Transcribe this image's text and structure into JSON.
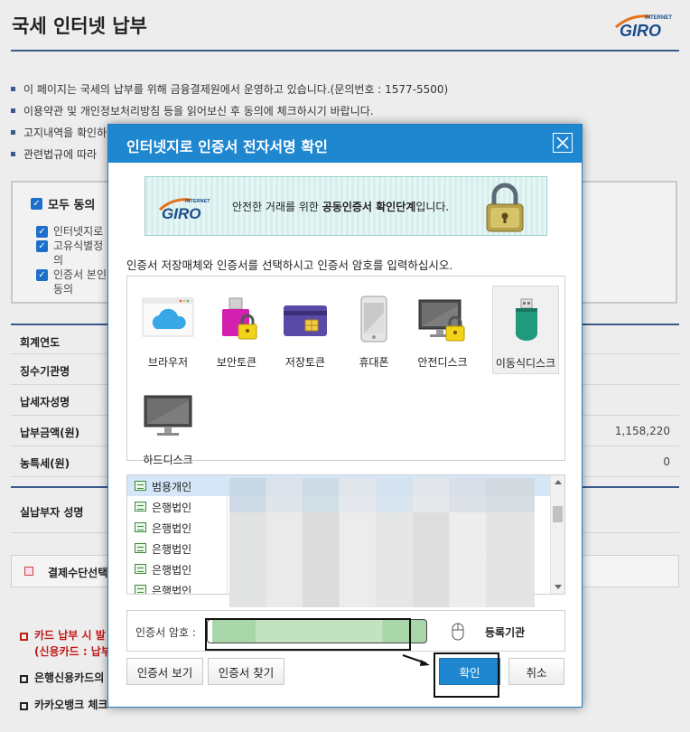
{
  "background": {
    "title": "국세 인터넷 납부",
    "logo_small": "INTERNET",
    "logo_main": "GIRO",
    "bullets": [
      "이 페이지는 국세의 납부를 위해 금융결제원에서 운영하고 있습니다.(문의번호 : 1577-5500)",
      "이용약관 및 개인정보처리방침 등을 읽어보신 후 동의에 체크하시기 바랍니다.",
      "고지내역을 확인하",
      "관련법규에 따라"
    ],
    "agree_all": "모두 동의",
    "agree_items": [
      "인터넷지로",
      "고유식별정",
      "의",
      "인증서 본인",
      "동의"
    ],
    "table": [
      {
        "label": "회계연도",
        "value": ""
      },
      {
        "label": "징수기관명",
        "value": ""
      },
      {
        "label": "납세자성명",
        "value": ""
      },
      {
        "label": "납부금액(원)",
        "value": "1,158,220"
      },
      {
        "label": "농특세(원)",
        "value": "0"
      }
    ],
    "actual_payer": "실납부자 성명",
    "payment_method": "결제수단선택",
    "notices": {
      "red_line1": "카드 납부 시 발",
      "red_line2": "(신용카드 : 납부",
      "line3": "은행신용카드의",
      "line4": "카카오뱅크 체크"
    }
  },
  "dialog": {
    "title": "인터넷지로 인증서 전자서명 확인",
    "banner": {
      "logo_small": "INTERNET",
      "logo_main": "GIRO",
      "text_prefix": "안전한 거래를 위한 ",
      "text_bold": "공동인증서 확인단계",
      "text_suffix": "입니다."
    },
    "instruction": "인증서 저장매체와 인증서를 선택하시고 인증서 암호를 입력하십시오.",
    "media": [
      {
        "label": "브라우저",
        "icon": "browser-cloud-icon"
      },
      {
        "label": "보안토큰",
        "icon": "security-token-icon"
      },
      {
        "label": "저장토큰",
        "icon": "storage-token-icon"
      },
      {
        "label": "휴대폰",
        "icon": "mobile-phone-icon"
      },
      {
        "label": "안전디스크",
        "icon": "secure-disk-icon"
      },
      {
        "label": "이동식디스크",
        "icon": "removable-disk-icon"
      },
      {
        "label": "하드디스크",
        "icon": "hard-disk-icon"
      }
    ],
    "selected_media": "이동식디스크",
    "certificates": [
      "범용개인",
      "은행법인",
      "은행법인",
      "은행법인",
      "은행법인",
      "은행법인"
    ],
    "password_label": "인증서 암호 :",
    "password_value": "",
    "registry_label": "등록기관",
    "buttons": {
      "view": "인증서 보기",
      "find": "인증서 찾기",
      "ok": "확인",
      "cancel": "취소"
    },
    "colors": {
      "header": "#1f86d0",
      "ok_button": "#1f86d0",
      "selected_row": "#d4e6f8"
    }
  }
}
